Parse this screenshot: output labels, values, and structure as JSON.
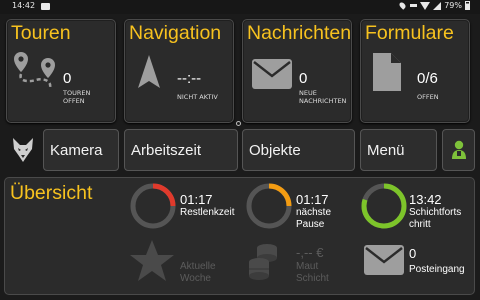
{
  "status_bar": {
    "time": "14:42",
    "battery": "79%",
    "icons": [
      "message-icon",
      "location-icon",
      "key-icon",
      "wifi-icon",
      "signal-icon",
      "battery-icon"
    ]
  },
  "tiles": {
    "touren": {
      "title": "Touren",
      "value": "0",
      "sub1": "TOUREN",
      "sub2": "OFFEN",
      "icon": "route-icon"
    },
    "navigation": {
      "title": "Navigation",
      "value": "--:--",
      "sub1": "NICHT AKTIV",
      "icon": "navigation-arrow-icon"
    },
    "nachrichten": {
      "title": "Nachrichten",
      "value": "0",
      "sub1": "NEUE",
      "sub2": "NACHRICHTEN",
      "icon": "envelope-icon"
    },
    "formulare": {
      "title": "Formulare",
      "value": "0/6",
      "sub1": "OFFEN",
      "icon": "document-icon"
    }
  },
  "buttons": {
    "kamera": "Kamera",
    "arbeitszeit": "Arbeitszeit",
    "objekte": "Objekte",
    "menu": "Menü"
  },
  "overview": {
    "title": "Übersicht",
    "restlenkzeit": {
      "value": "01:17",
      "label": "Restlenkzeit",
      "progress": 0.25
    },
    "pause": {
      "value": "01:17",
      "label1": "nächste",
      "label2": "Pause",
      "progress": 0.25
    },
    "schicht": {
      "value": "13:42",
      "label1": "Schichtforts",
      "label2": "chritt",
      "progress": 0.8
    },
    "woche": {
      "label1": "Aktuelle",
      "label2": "Woche"
    },
    "maut": {
      "value": "-,-- €",
      "label1": "Maut",
      "label2": "Schicht"
    },
    "posteingang": {
      "value": "0",
      "label": "Posteingang"
    }
  },
  "colors": {
    "accent": "#f7c21f",
    "ring_red": "#e03a2c",
    "ring_orange": "#f39c12",
    "ring_green": "#7dc42a",
    "ring_track": "#555555",
    "user_icon": "#7ec23a"
  }
}
